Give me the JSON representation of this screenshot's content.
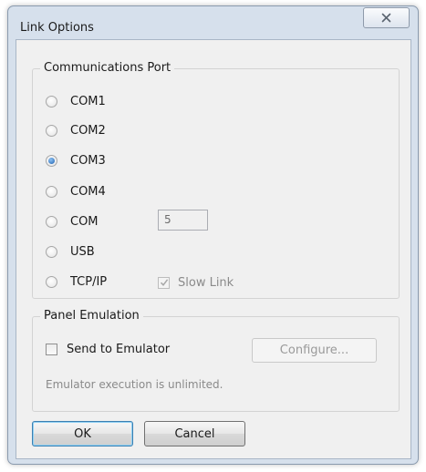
{
  "window": {
    "title": "Link Options"
  },
  "comm_port": {
    "group_title": "Communications Port",
    "options": [
      {
        "label": "COM1",
        "checked": false
      },
      {
        "label": "COM2",
        "checked": false
      },
      {
        "label": "COM3",
        "checked": true
      },
      {
        "label": "COM4",
        "checked": false
      },
      {
        "label": "COM",
        "checked": false
      },
      {
        "label": "USB",
        "checked": false
      },
      {
        "label": "TCP/IP",
        "checked": false
      }
    ],
    "com_number_value": "5",
    "slow_link": {
      "label": "Slow Link",
      "checked": true,
      "enabled": false
    }
  },
  "panel_emulation": {
    "group_title": "Panel Emulation",
    "send_to_emulator": {
      "label": "Send to Emulator",
      "checked": false
    },
    "configure_label": "Configure...",
    "status_text": "Emulator execution is unlimited."
  },
  "buttons": {
    "ok_label": "OK",
    "cancel_label": "Cancel"
  },
  "icons": {
    "close": "close-icon",
    "check": "checkmark-icon"
  },
  "colors": {
    "radio_selected": "#1d5fae",
    "frame": "#d6e0ec",
    "client_bg": "#f0f0f0"
  }
}
